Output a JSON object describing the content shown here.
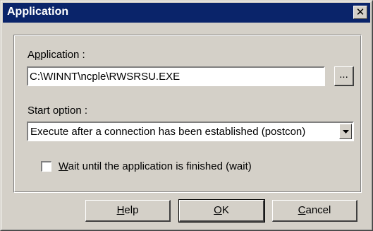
{
  "window": {
    "title": "Application",
    "close_icon": "close-icon"
  },
  "application": {
    "label_prefix": "A",
    "label_underlined": "p",
    "label_suffix": "plication :",
    "value": "C:\\WINNT\\ncple\\RWSRSU.EXE",
    "browse_label": "..."
  },
  "start_option": {
    "label": "Start option :",
    "selected": "Execute after a connection has been established (postcon)"
  },
  "wait": {
    "underlined": "W",
    "rest": "ait until the application is finished  (wait)",
    "checked": false
  },
  "buttons": {
    "help": {
      "underlined": "H",
      "rest": "elp"
    },
    "ok": {
      "underlined": "O",
      "rest": "K"
    },
    "cancel": {
      "underlined": "C",
      "rest": "ancel"
    }
  }
}
